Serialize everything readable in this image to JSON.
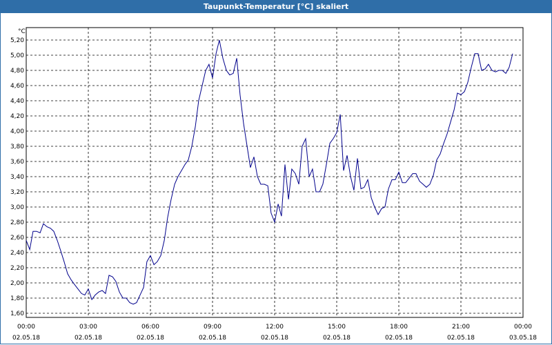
{
  "window": {
    "title": "Taupunkt-Temperatur [°C] skaliert"
  },
  "chart_data": {
    "type": "line",
    "title": "Taupunkt-Temperatur [°C] skaliert",
    "ylabel": "°C",
    "xlabel": "",
    "ylim": [
      1.6,
      5.3
    ],
    "xlim": [
      0,
      24
    ],
    "grid": true,
    "line_color": "#00008b",
    "yticks": [
      "1,60",
      "1,80",
      "2,00",
      "2,20",
      "2,40",
      "2,60",
      "2,80",
      "3,00",
      "3,20",
      "3,40",
      "3,60",
      "3,80",
      "4,00",
      "4,20",
      "4,40",
      "4,60",
      "4,80",
      "5,00",
      "5,20"
    ],
    "xticks": [
      {
        "time": "00:00",
        "date": "02.05.18"
      },
      {
        "time": "03:00",
        "date": "02.05.18"
      },
      {
        "time": "06:00",
        "date": "02.05.18"
      },
      {
        "time": "09:00",
        "date": "02.05.18"
      },
      {
        "time": "12:00",
        "date": "02.05.18"
      },
      {
        "time": "15:00",
        "date": "02.05.18"
      },
      {
        "time": "18:00",
        "date": "02.05.18"
      },
      {
        "time": "21:00",
        "date": "02.05.18"
      },
      {
        "time": "00:00",
        "date": "03.05.18"
      }
    ],
    "x": [
      0,
      0.17,
      0.33,
      0.5,
      0.67,
      0.83,
      1,
      1.17,
      1.33,
      1.5,
      1.67,
      1.83,
      2,
      2.17,
      2.33,
      2.5,
      2.67,
      2.83,
      3,
      3.17,
      3.33,
      3.5,
      3.67,
      3.83,
      4,
      4.17,
      4.33,
      4.5,
      4.67,
      4.83,
      5,
      5.17,
      5.33,
      5.5,
      5.67,
      5.83,
      6,
      6.17,
      6.33,
      6.5,
      6.67,
      6.83,
      7,
      7.17,
      7.33,
      7.5,
      7.67,
      7.83,
      8,
      8.17,
      8.33,
      8.5,
      8.67,
      8.83,
      9,
      9.17,
      9.33,
      9.5,
      9.67,
      9.83,
      10,
      10.17,
      10.33,
      10.5,
      10.67,
      10.83,
      11,
      11.17,
      11.33,
      11.5,
      11.67,
      11.83,
      12,
      12.17,
      12.33,
      12.5,
      12.67,
      12.83,
      13,
      13.17,
      13.33,
      13.5,
      13.67,
      13.83,
      14,
      14.17,
      14.33,
      14.5,
      14.67,
      14.83,
      15,
      15.17,
      15.33,
      15.5,
      15.67,
      15.83,
      16,
      16.17,
      16.33,
      16.5,
      16.67,
      16.83,
      17,
      17.17,
      17.33,
      17.5,
      17.67,
      17.83,
      18,
      18.17,
      18.33,
      18.5,
      18.67,
      18.83,
      19,
      19.17,
      19.33,
      19.5,
      19.67,
      19.83,
      20,
      20.17,
      20.33,
      20.5,
      20.67,
      20.83,
      21,
      21.17,
      21.33,
      21.5,
      21.67,
      21.83,
      22,
      22.17,
      22.33,
      22.5,
      22.67,
      22.83,
      23,
      23.17,
      23.33,
      23.5,
      23.67,
      23.83,
      24
    ],
    "series": [
      {
        "values": [
          2.56,
          2.44,
          2.68,
          2.68,
          2.66,
          2.78,
          2.74,
          2.72,
          2.68,
          2.56,
          2.42,
          2.28,
          2.12,
          2.04,
          1.98,
          1.92,
          1.86,
          1.84,
          1.92,
          1.78,
          1.84,
          1.88,
          1.9,
          1.86,
          2.1,
          2.08,
          2.02,
          1.88,
          1.8,
          1.8,
          1.74,
          1.72,
          1.74,
          1.84,
          1.94,
          2.28,
          2.36,
          2.24,
          2.28,
          2.36,
          2.56,
          2.86,
          3.1,
          3.3,
          3.4,
          3.48,
          3.56,
          3.62,
          3.8,
          4.06,
          4.4,
          4.6,
          4.8,
          4.88,
          4.7,
          5.02,
          5.2,
          4.96,
          4.8,
          4.74,
          4.76,
          4.96,
          4.48,
          4.1,
          3.8,
          3.52,
          3.66,
          3.4,
          3.3,
          3.3,
          3.28,
          2.92,
          2.8,
          3.04,
          2.88,
          3.56,
          3.1,
          3.5,
          3.44,
          3.3,
          3.8,
          3.9,
          3.4,
          3.5,
          3.2,
          3.2,
          3.3,
          3.56,
          3.84,
          3.9,
          3.98,
          4.22,
          3.48,
          3.68,
          3.4,
          3.22,
          3.64,
          3.24,
          3.26,
          3.36,
          3.12,
          3.0,
          2.9,
          2.98,
          3.0,
          3.24,
          3.36,
          3.36,
          3.46,
          3.32,
          3.32,
          3.38,
          3.44,
          3.44,
          3.34,
          3.3,
          3.26,
          3.3,
          3.42,
          3.62,
          3.7,
          3.84,
          3.96,
          4.12,
          4.28,
          4.5,
          4.48,
          4.52,
          4.64,
          4.84,
          5.02,
          5.02,
          4.8,
          4.82,
          4.88,
          4.8,
          4.78,
          4.8,
          4.8,
          4.76,
          4.84,
          5.02
        ]
      }
    ]
  }
}
